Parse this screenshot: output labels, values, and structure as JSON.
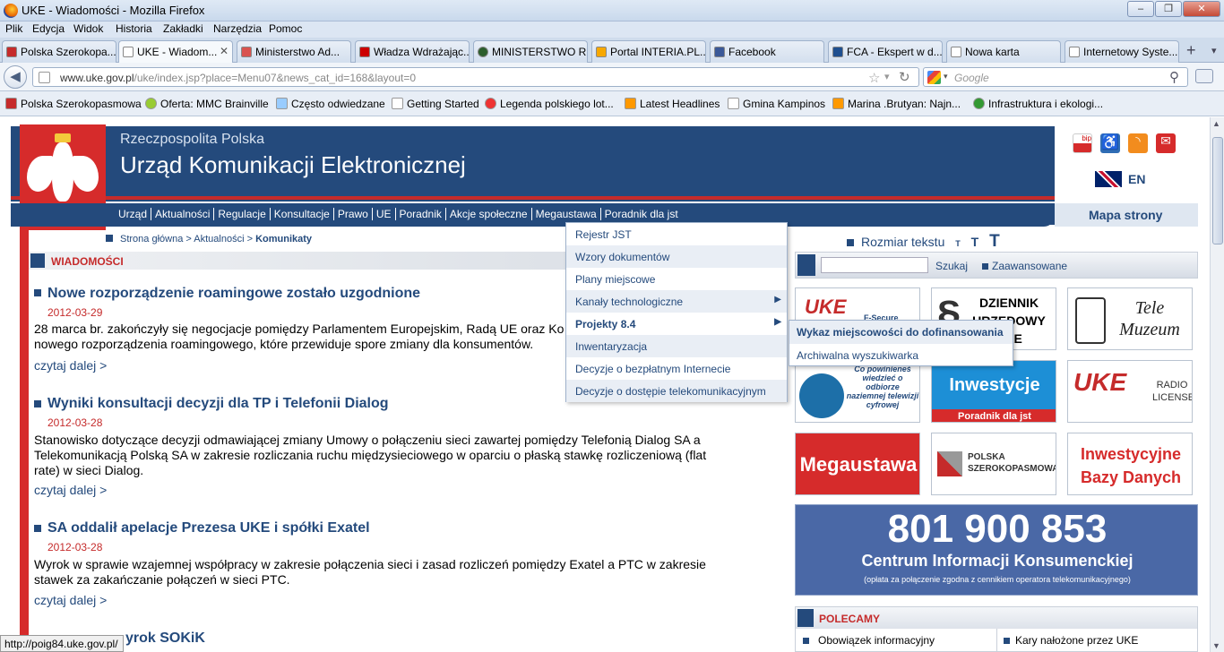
{
  "window": {
    "title": "UKE - Wiadomości - Mozilla Firefox",
    "controls": [
      "–",
      "❐",
      "✕"
    ]
  },
  "menubar": [
    "Plik",
    "Edycja",
    "Widok",
    "Historia",
    "Zakładki",
    "Narzędzia",
    "Pomoc"
  ],
  "tabs": [
    "Polska Szerokopa...",
    "UKE - Wiadom...",
    "Ministerstwo Ad...",
    "Władza Wdrażając...",
    "MINISTERSTWO R...",
    "Portal INTERIA.PL...",
    "Facebook",
    "FCA - Ekspert w d...",
    "Nowa karta",
    "Internetowy Syste..."
  ],
  "toolbar": {
    "url_host": "www.uke.gov.pl",
    "url_path": "/uke/index.jsp?place=Menu07&news_cat_id=168&layout=0",
    "search_placeholder": "Google",
    "new_tab": "+"
  },
  "bookmarks": [
    "Polska Szerokopasmowa",
    "Oferta: MMC Brainville",
    "Często odwiedzane",
    "Getting Started",
    "Legenda polskiego lot...",
    "Latest Headlines",
    "Gmina Kampinos",
    "Marina .Brutyan: Najn...",
    "Infrastruktura i ekologi..."
  ],
  "header": {
    "line1": "Rzeczpospolita Polska",
    "line2": "Urząd Komunikacji Elektronicznej",
    "bip": "bip",
    "lang": "EN"
  },
  "nav": [
    "Urząd",
    "Aktualności",
    "Regulacje",
    "Konsultacje",
    "Prawo",
    "UE",
    "Poradnik",
    "Akcje społeczne",
    "Megaustawa",
    "Poradnik dla jst"
  ],
  "sitemap": "Mapa strony",
  "breadcrumb": {
    "a": "Strona główna",
    "sep": " > ",
    "b": "Aktualności",
    "c": "Komunikaty"
  },
  "section_title": "WIADOMOŚCI",
  "news": [
    {
      "title": "Nowe rozporządzenie roamingowe zostało uzgodnione",
      "date": "2012-03-29",
      "text": "28 marca br. zakończyły się negocjacje pomiędzy Parlamentem Europejskim, Radą UE oraz Ko",
      "text2": "nowego rozporządzenia roamingowego, które przewiduje spore zmiany dla konsumentów.",
      "more": "czytaj dalej >"
    },
    {
      "title": "Wyniki konsultacji decyzji dla TP i Telefonii Dialog",
      "date": "2012-03-28",
      "text": "Stanowisko dotyczące decyzji odmawiającej zmiany Umowy o połączeniu sieci zawartej pomiędzy Telefonią Dialog SA a Telekomunikacją Polską SA w zakresie rozliczania ruchu międzysieciowego w oparciu o płaską stawkę rozliczeniową (flat rate) w sieci Dialog.",
      "more": "czytaj dalej >"
    },
    {
      "title": "SA oddalił apelacje Prezesa UKE i spółki Exatel",
      "date": "2012-03-28",
      "text": "Wyrok w sprawie wzajemnej współpracy w zakresie połączenia sieci i zasad rozliczeń pomiędzy Exatel a PTC w zakresie stawek za zakańczanie połączeń w sieci PTC.",
      "more": "czytaj dalej >"
    },
    {
      "title": "yrok SOKiK"
    }
  ],
  "dropdown": [
    "Rejestr JST",
    "Wzory dokumentów",
    "Plany miejscowe",
    "Kanały technologiczne",
    "Projekty 8.4",
    "Inwentaryzacja",
    "Decyzje o bezpłatnym Internecie",
    "Decyzje o dostępie telekomunikacyjnym"
  ],
  "submenu": [
    "Wykaz miejscowości do dofinansowania",
    "Archiwalna wyszukiwarka"
  ],
  "textsize": {
    "label": "Rozmiar tekstu",
    "t": "T"
  },
  "sitesearch": {
    "search": "Szukaj",
    "advanced": "Zaawansowane"
  },
  "tiles": {
    "dziennik": "DZIENNIK URZĘDOWY UKE",
    "tele": "Tele Muzeum",
    "fsecure": "F-Secure",
    "tv": "Co powinieneś wiedzieć o odbiorze naziemnej telewizji cyfrowej",
    "inwest": "Inwestycje",
    "inwest_sub": "Poradnik dla jst",
    "radio": "RADIO LICENSE",
    "mega": "Megaustawa",
    "psz": "POLSKA SZEROKOPASMOWA",
    "bazy": "Inwestycyjne Bazy Danych"
  },
  "info": {
    "number": "801 900 853",
    "label": "Centrum Informacji Konsumenckiej",
    "note": "(opłata za połączenie zgodna z cennikiem operatora telekomunikacyjnego)"
  },
  "polecamy": {
    "title": "POLECAMY",
    "item1": "Obowiązek informacyjny",
    "item2": "Kary nałożone przez UKE"
  },
  "status": "http://poig84.uke.gov.pl/"
}
